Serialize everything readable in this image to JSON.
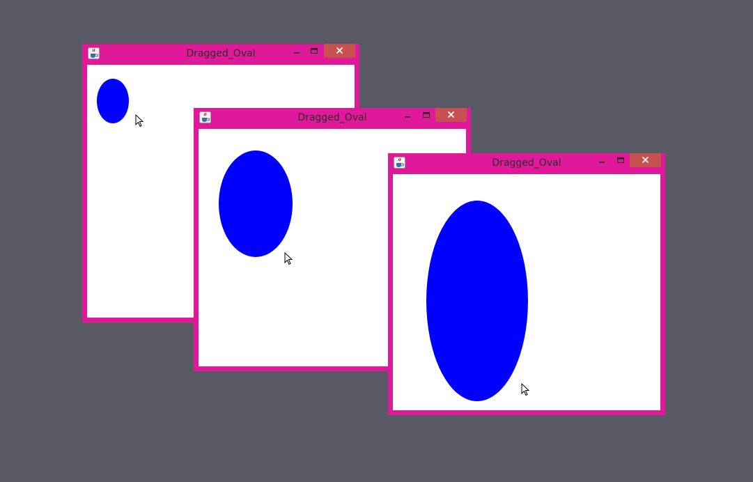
{
  "desktop": {
    "background": "#595a65"
  },
  "theme": {
    "window_frame_color": "#e0189a",
    "close_button_color": "#c75050",
    "oval_color": "#0000ff",
    "client_background": "#ffffff"
  },
  "windows": [
    {
      "title": "Dragged_Oval",
      "app_icon": "java-cup-icon",
      "buttons": {
        "minimize": "minimize-icon",
        "maximize": "maximize-icon",
        "close": "close-icon"
      }
    },
    {
      "title": "Dragged_Oval",
      "app_icon": "java-cup-icon",
      "buttons": {
        "minimize": "minimize-icon",
        "maximize": "maximize-icon",
        "close": "close-icon"
      }
    },
    {
      "title": "Dragged_Oval",
      "app_icon": "java-cup-icon",
      "buttons": {
        "minimize": "minimize-icon",
        "maximize": "maximize-icon",
        "close": "close-icon"
      }
    }
  ]
}
